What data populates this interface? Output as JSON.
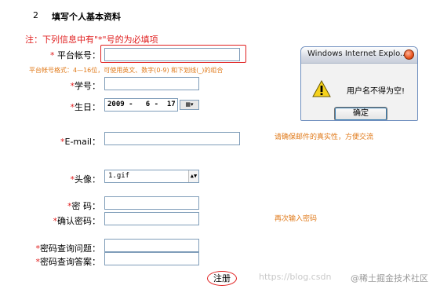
{
  "section": {
    "number": "2",
    "title": "填写个人基本资料"
  },
  "note": "注：下列信息中有\"*\"号的为必填项",
  "required_mark": "*",
  "form": {
    "account": {
      "label": "平台帐号：",
      "value": "",
      "hint": "平台帐号格式：4—16位，可使用英文、数字(0-9) 和下划线(_)的组合"
    },
    "student_id": {
      "label": "学号：",
      "value": ""
    },
    "birthday": {
      "label": "生日：",
      "value": "2009 -   6 -  17",
      "calendar_button": "▦▾"
    },
    "email": {
      "label": "E-mail：",
      "value": "",
      "hint": "请确保邮件的真实性，方便交流"
    },
    "avatar": {
      "label": "头像：",
      "selected": "1.gif"
    },
    "password": {
      "label": "密  码：",
      "value": ""
    },
    "confirm_password": {
      "label": "确认密码：",
      "value": "",
      "hint": "再次输入密码"
    },
    "security_question": {
      "label": "密码查询问题：",
      "value": ""
    },
    "security_answer": {
      "label": "密码查询答案：",
      "value": ""
    },
    "submit_label": "注册"
  },
  "dialog": {
    "title": "Windows Internet Explo...",
    "message": "用户名不得为空!",
    "ok_label": "确定",
    "icon": "warning-icon"
  },
  "watermark": {
    "left": "https://blog.csdn",
    "right": "@稀土掘金技术社区"
  },
  "colors": {
    "required": "#e02020",
    "hint": "#e07a1a",
    "field_border": "#7f9db9"
  }
}
